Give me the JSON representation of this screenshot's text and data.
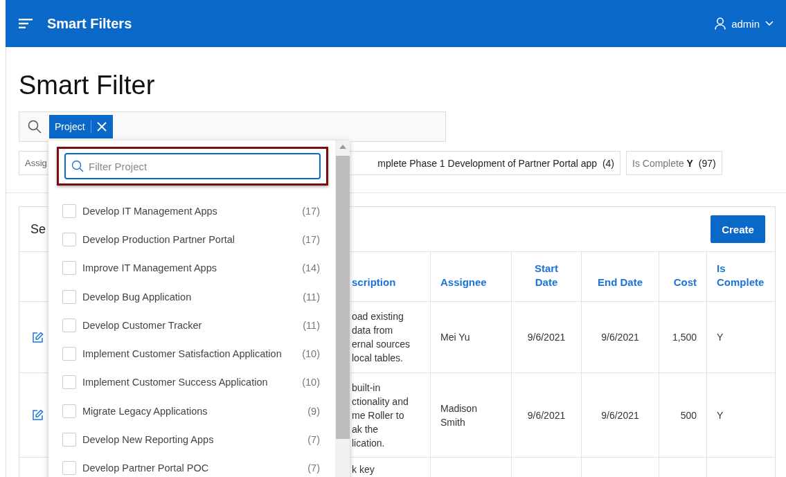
{
  "header": {
    "app_title": "Smart Filters",
    "user": "admin"
  },
  "page_title": "Smart Filter",
  "search": {
    "chips": [
      {
        "label": "Project"
      }
    ]
  },
  "suggestion_chips": [
    {
      "kind": "cut",
      "label": "Assig"
    },
    {
      "kind": "value",
      "label": "mplete Phase 1 Development of Partner Portal app",
      "count": "(4)"
    },
    {
      "kind": "pair",
      "label": "Is Complete",
      "value": "Y",
      "count": "(97)"
    }
  ],
  "report": {
    "title": "Se",
    "create_button": "Create",
    "columns": [
      "scription",
      "Assignee",
      "Start Date",
      "End Date",
      "Cost",
      "Is Complete"
    ],
    "rows": [
      {
        "editable": true,
        "description": "oad existing\ndata from\nernal sources\nlocal tables.",
        "assignee": "Mei Yu",
        "start_date": "9/6/2021",
        "end_date": "9/6/2021",
        "cost": "1,500",
        "is_complete": "Y"
      },
      {
        "editable": true,
        "description": "built-in\nctionality and\nme Roller to\nak the\nlication.",
        "assignee": "Madison Smith",
        "start_date": "9/6/2021",
        "end_date": "9/6/2021",
        "cost": "500",
        "is_complete": "Y"
      },
      {
        "editable": false,
        "description": "k key"
      }
    ]
  },
  "dropdown": {
    "placeholder": "Filter Project",
    "highlighted": true,
    "options": [
      {
        "label": "Develop IT Management Apps",
        "count": "(17)",
        "checked": false
      },
      {
        "label": "Develop Production Partner Portal",
        "count": "(17)",
        "checked": false
      },
      {
        "label": "Improve IT Management Apps",
        "count": "(14)",
        "checked": false
      },
      {
        "label": "Develop Bug Application",
        "count": "(11)",
        "checked": false
      },
      {
        "label": "Develop Customer Tracker",
        "count": "(11)",
        "checked": false
      },
      {
        "label": "Implement Customer Satisfaction Application",
        "count": "(10)",
        "checked": false
      },
      {
        "label": "Implement Customer Success Application",
        "count": "(10)",
        "checked": false
      },
      {
        "label": "Migrate Legacy Applications",
        "count": "(9)",
        "checked": false
      },
      {
        "label": "Develop New Reporting Apps",
        "count": "(7)",
        "checked": false
      },
      {
        "label": "Develop Partner Portal POC",
        "count": "(7)",
        "checked": false
      }
    ]
  }
}
